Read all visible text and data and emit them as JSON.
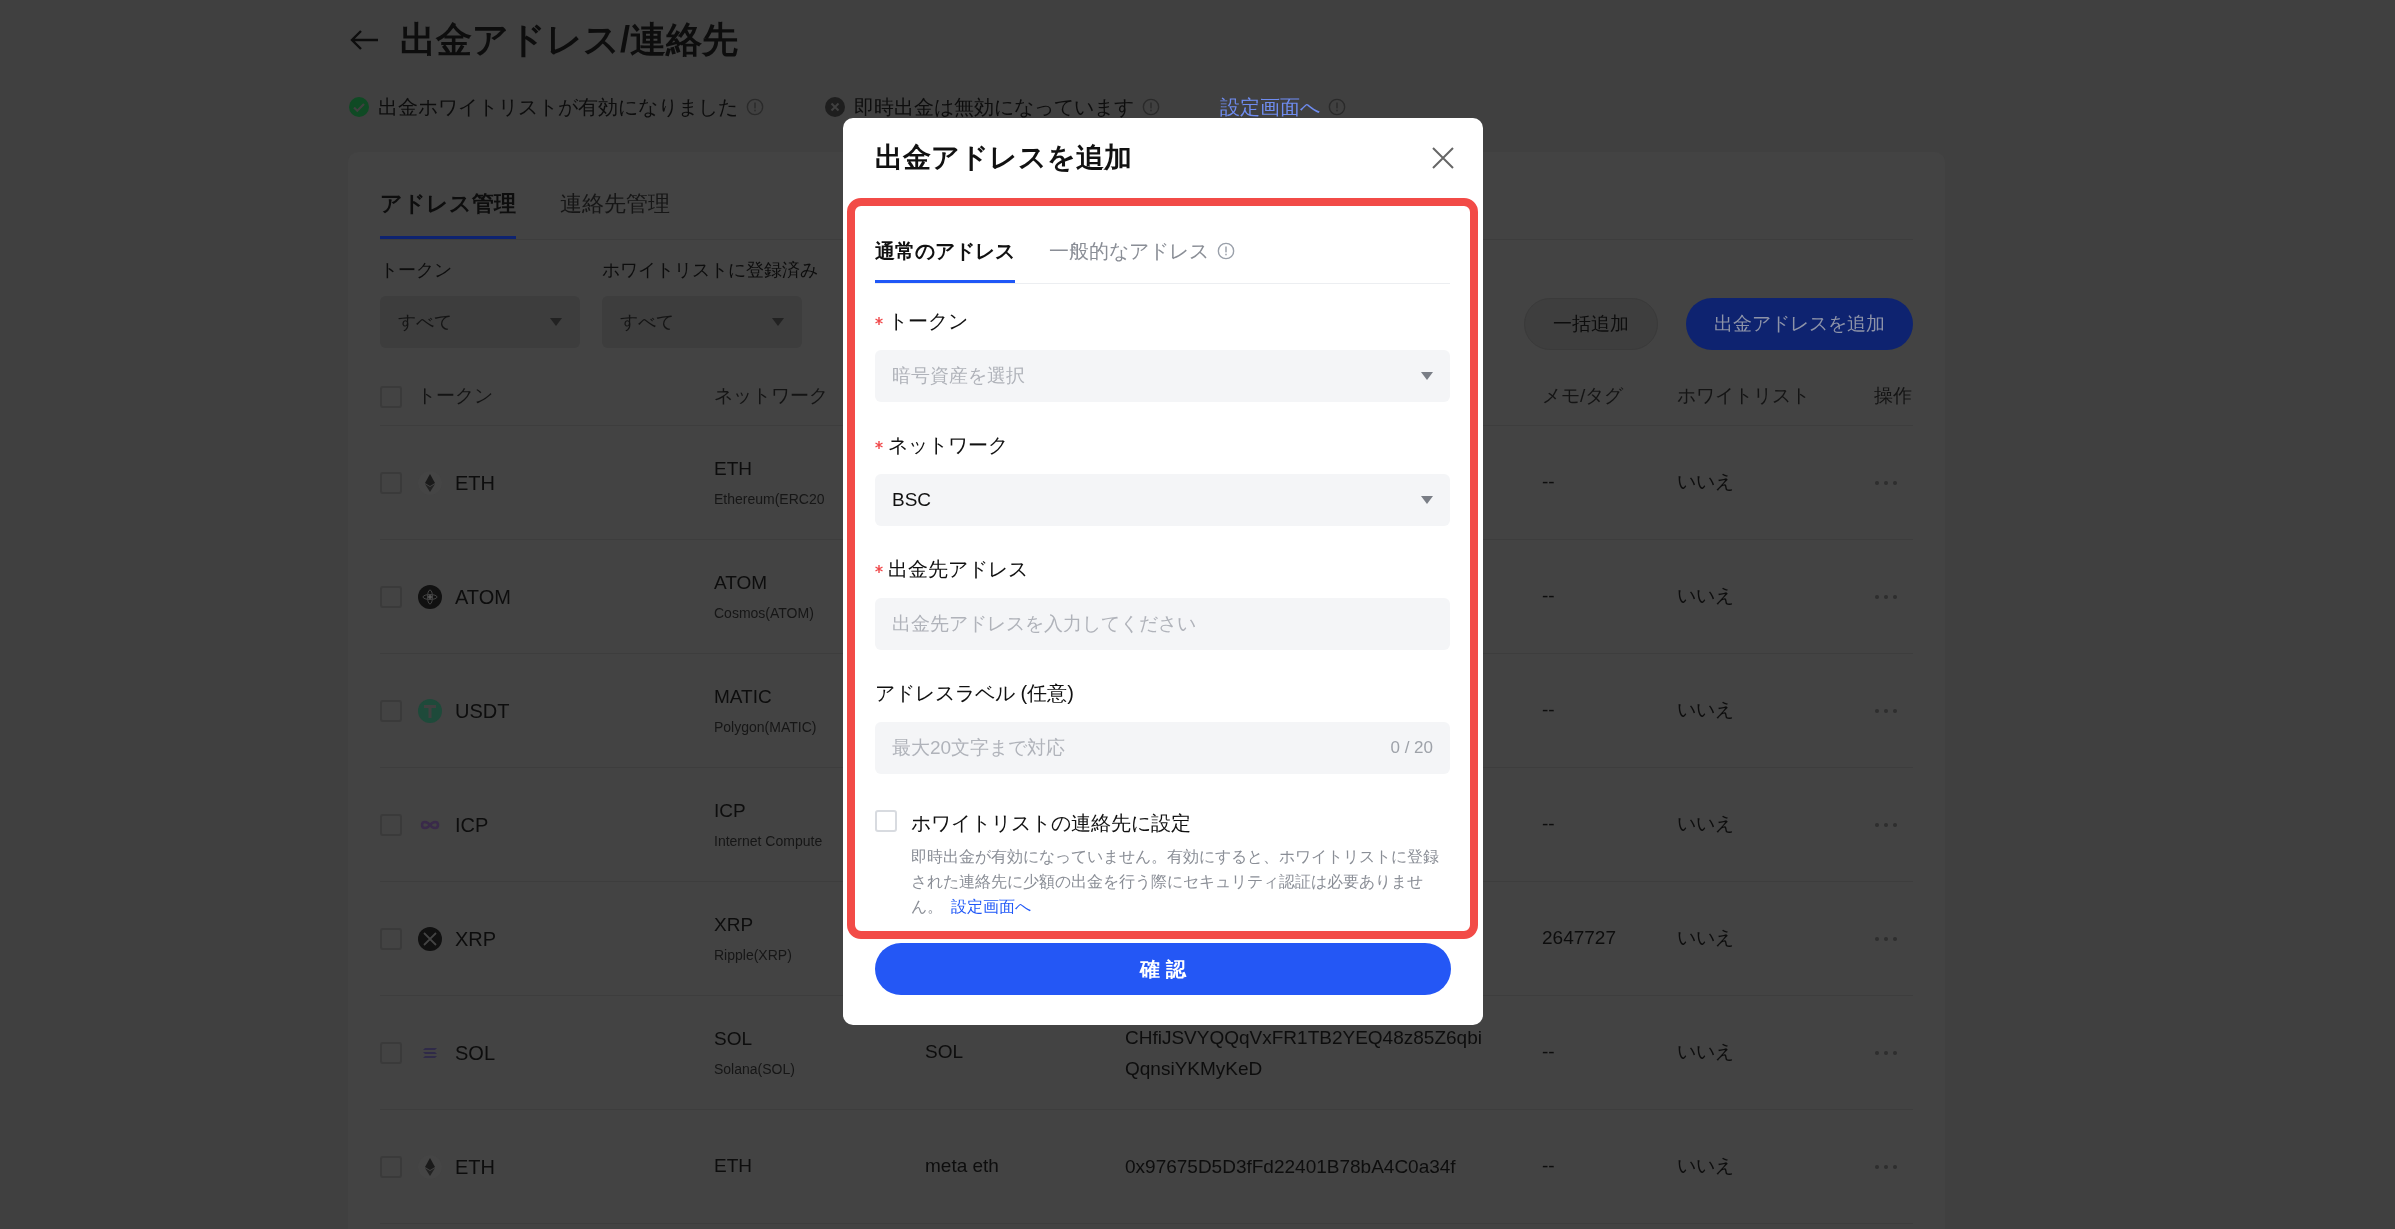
{
  "header": {
    "title": "出金アドレス/連絡先"
  },
  "statuses": [
    {
      "kind": "ok",
      "text": "出金ホワイトリストが有効になりました"
    },
    {
      "kind": "off",
      "text": "即時出金は無効になっています"
    }
  ],
  "settings_link": "設定画面へ",
  "tabs": [
    {
      "label": "アドレス管理",
      "selected": true
    },
    {
      "label": "連絡先管理",
      "selected": false
    }
  ],
  "filters": [
    {
      "label": "トークン",
      "value": "すべて"
    },
    {
      "label": "ホワイトリストに登録済み",
      "value": "すべて"
    }
  ],
  "actions": [
    {
      "label": "一括追加",
      "kind": "secondary"
    },
    {
      "label": "出金アドレスを追加",
      "kind": "primary"
    }
  ],
  "table": {
    "select_all_checked": false,
    "columns": [
      "トークン",
      "ネットワーク",
      "メモ/タグ",
      "ホワイトリスト",
      "操作"
    ],
    "rows": [
      {
        "kind": "eth",
        "token": "ETH",
        "network": "ETH",
        "network_full": "Ethereum(ERC20",
        "memo": "--",
        "whitelist": "いいえ",
        "checked": false
      },
      {
        "kind": "atom",
        "token": "ATOM",
        "network": "ATOM",
        "network_full": "Cosmos(ATOM)",
        "memo": "--",
        "whitelist": "いいえ",
        "checked": false
      },
      {
        "kind": "usdt",
        "token": "USDT",
        "network": "MATIC",
        "network_full": "Polygon(MATIC)",
        "memo": "--",
        "whitelist": "いいえ",
        "checked": false
      },
      {
        "kind": "icp",
        "token": "ICP",
        "network": "ICP",
        "network_full": "Internet Compute",
        "memo": "--",
        "whitelist": "いいえ",
        "checked": false
      },
      {
        "kind": "xrp",
        "token": "XRP",
        "network": "XRP",
        "network_full": "Ripple(XRP)",
        "memo": "2647727",
        "whitelist": "いいえ",
        "checked": false
      },
      {
        "kind": "sol",
        "token": "SOL",
        "network": "SOL",
        "network_full": "Solana(SOL)",
        "column_3": "SOL",
        "address": "CHfiJSVYQQqVxFR1TB2YEQ48z85Z6qbiQqnsiYKMyKeD",
        "memo": "--",
        "whitelist": "いいえ",
        "checked": false
      },
      {
        "kind": "eth",
        "token": "ETH",
        "network": "ETH",
        "column_3": "meta eth",
        "address": "0x97675D5D3fFd22401B78bA4C0a34f",
        "memo": "--",
        "whitelist": "いいえ",
        "checked": false
      }
    ]
  },
  "modal": {
    "title": "出金アドレスを追加",
    "tabs": [
      {
        "label": "通常のアドレス",
        "selected": true,
        "info": false
      },
      {
        "label": "一般的なアドレス",
        "selected": false,
        "info": true
      }
    ],
    "fields": [
      {
        "kind": "select",
        "label": "トークン",
        "required": true,
        "placeholder": "暗号資産を選択"
      },
      {
        "kind": "select",
        "label": "ネットワーク",
        "required": true,
        "value": "BSC"
      },
      {
        "kind": "input",
        "label": "出金先アドレス",
        "required": true,
        "placeholder": "出金先アドレスを入力してください"
      },
      {
        "kind": "input",
        "label": "アドレスラベル (任意)",
        "required": false,
        "placeholder": "最大20文字まで対応",
        "counter": "0 / 20"
      }
    ],
    "whitelist_option": {
      "label": "ホワイトリストの連絡先に設定",
      "checked": false,
      "description": "即時出金が有効になっていません。有効にすると、ホワイトリストに登録された連絡先に少額の出金を行う際にセキュリティ認証は必要ありません。",
      "link": "設定画面へ"
    },
    "confirm": "確 認"
  }
}
